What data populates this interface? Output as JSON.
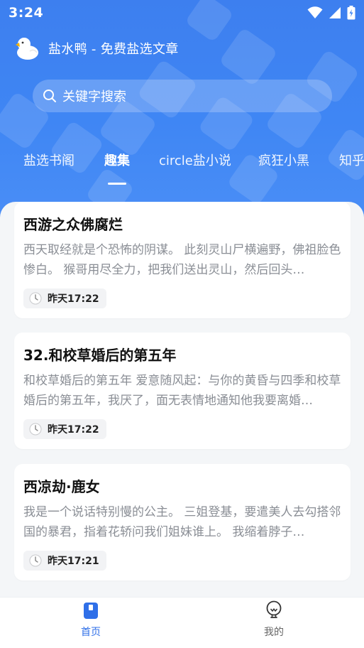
{
  "status_bar": {
    "time": "3:24"
  },
  "app": {
    "title": "盐水鸭 - 免费盐选文章"
  },
  "search": {
    "placeholder": "关键字搜索"
  },
  "tabs": [
    {
      "label": "盐选书阁",
      "active": false
    },
    {
      "label": "趣集",
      "active": true
    },
    {
      "label": "circle盐小说",
      "active": false
    },
    {
      "label": "疯狂小黑",
      "active": false
    },
    {
      "label": "知乎",
      "active": false
    }
  ],
  "articles": [
    {
      "title": "西游之众佛腐烂",
      "summary": "西天取经就是个恐怖的阴谋。 此刻灵山尸横遍野，佛祖脸色惨白。 猴哥用尽全力，把我们送出灵山，然后回头…",
      "time": "昨天17:22"
    },
    {
      "title": "32.和校草婚后的第五年",
      "summary": "和校草婚后的第五年 爱意随风起：与你的黄昏与四季和校草婚后的第五年，我厌了，面无表情地通知他我要离婚…",
      "time": "昨天17:22"
    },
    {
      "title": "西凉劫·鹿女",
      "summary": "我是一个说话特别慢的公主。 三姐登基，要遣美人去勾搭邻国的暴君，指着花轿问我们姐妹谁上。 我缩着脖子…",
      "time": "昨天17:21"
    }
  ],
  "bottom_nav": [
    {
      "label": "首页",
      "active": true,
      "icon": "home-icon"
    },
    {
      "label": "我的",
      "active": false,
      "icon": "lightbulb-icon"
    }
  ],
  "colors": {
    "primary": "#3f86f4",
    "nav_active": "#2f6fe8",
    "nav_inactive": "#666666"
  }
}
